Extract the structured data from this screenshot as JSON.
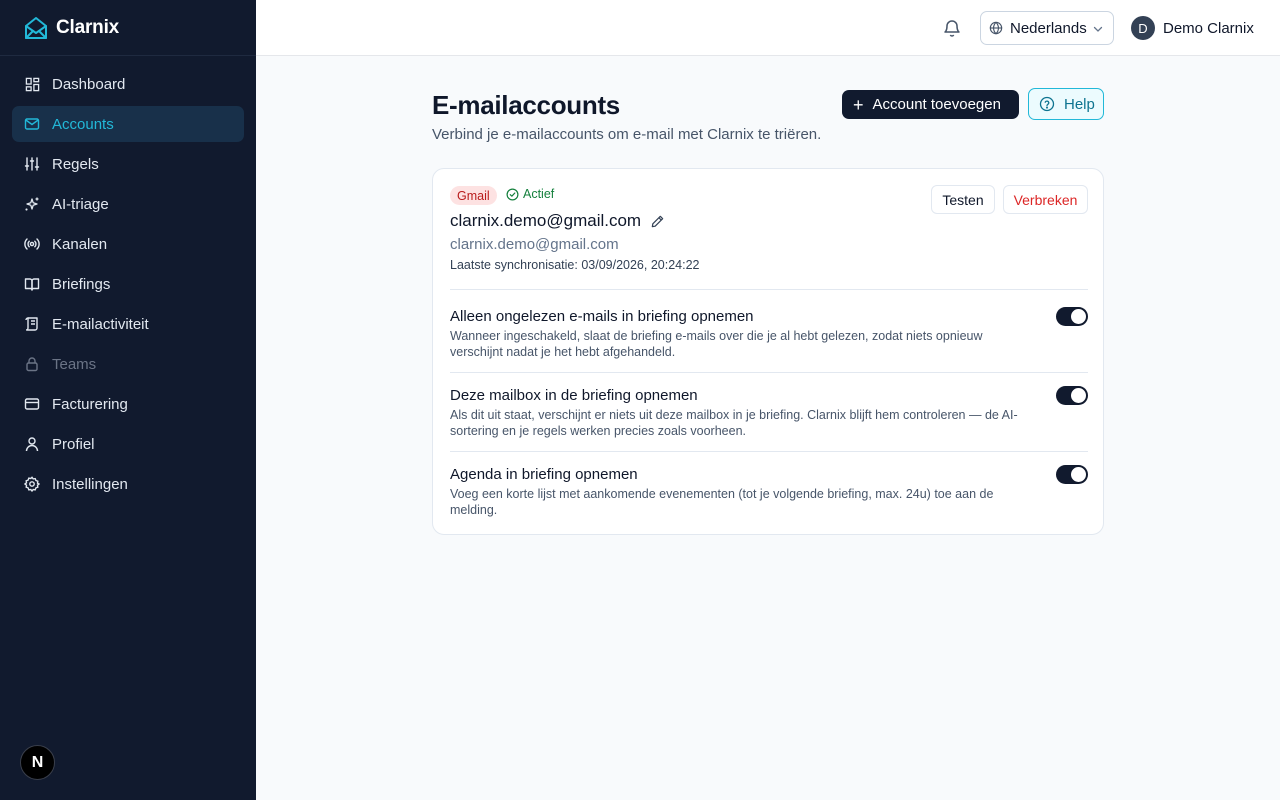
{
  "brand": {
    "name": "Clarnix",
    "accent": "#22b8d8"
  },
  "sidebar": {
    "items": [
      {
        "label": "Dashboard",
        "icon": "dashboard-icon"
      },
      {
        "label": "Accounts",
        "icon": "mail-icon",
        "active": true
      },
      {
        "label": "Regels",
        "icon": "sliders-icon"
      },
      {
        "label": "AI-triage",
        "icon": "sparkles-icon"
      },
      {
        "label": "Kanalen",
        "icon": "radio-icon"
      },
      {
        "label": "Briefings",
        "icon": "book-icon"
      },
      {
        "label": "E-mailactiviteit",
        "icon": "scroll-icon"
      },
      {
        "label": "Teams",
        "icon": "lock-icon",
        "disabled": true
      },
      {
        "label": "Facturering",
        "icon": "credit-card-icon"
      },
      {
        "label": "Profiel",
        "icon": "user-icon"
      },
      {
        "label": "Instellingen",
        "icon": "gear-icon"
      }
    ],
    "bottom_badge": "N"
  },
  "topbar": {
    "language": "Nederlands",
    "user_initial": "D",
    "user_name": "Demo Clarnix"
  },
  "main": {
    "title": "E-mailaccounts",
    "subtitle": "Verbind je e-mailaccounts om e-mail met Clarnix te triëren.",
    "add_button": "Account toevoegen",
    "help_button": "Help"
  },
  "account": {
    "provider": "Gmail",
    "status": "Actief",
    "name": "clarnix.demo@gmail.com",
    "email": "clarnix.demo@gmail.com",
    "last_sync": "Laatste synchronisatie: 03/09/2026, 20:24:22",
    "test_button": "Testen",
    "disconnect_button": "Verbreken",
    "settings": [
      {
        "title": "Alleen ongelezen e-mails in briefing opnemen",
        "desc": "Wanneer ingeschakeld, slaat de briefing e-mails over die je al hebt gelezen, zodat niets opnieuw verschijnt nadat je het hebt afgehandeld.",
        "enabled": true
      },
      {
        "title": "Deze mailbox in de briefing opnemen",
        "desc": "Als dit uit staat, verschijnt er niets uit deze mailbox in je briefing. Clarnix blijft hem controleren — de AI-sortering en je regels werken precies zoals voorheen.",
        "enabled": true
      },
      {
        "title": "Agenda in briefing opnemen",
        "desc": "Voeg een korte lijst met aankomende evenementen (tot je volgende briefing, max. 24u) toe aan de melding.",
        "enabled": true
      }
    ]
  }
}
